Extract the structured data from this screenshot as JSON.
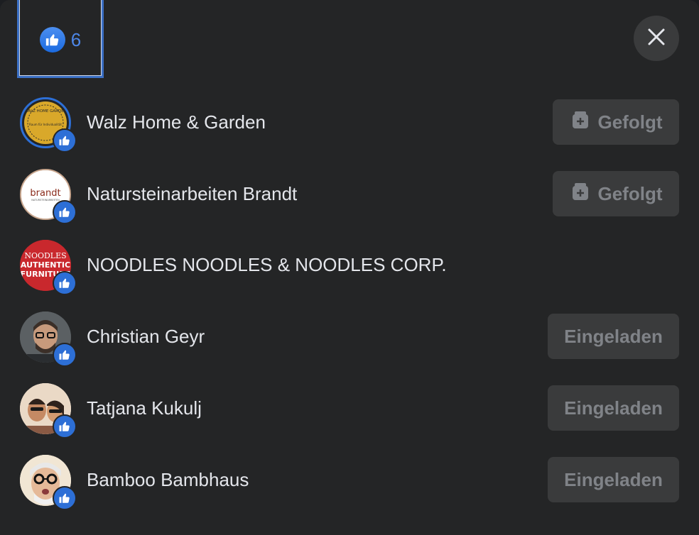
{
  "header": {
    "tab_all_count": "6",
    "tab_icon": "like-icon",
    "close_icon": "close-icon"
  },
  "colors": {
    "background": "#242526",
    "like_blue": "#2d6fd6",
    "count_blue": "#4d87e8",
    "button_bg": "#3a3b3c",
    "button_text": "#808388"
  },
  "people": [
    {
      "name": "Walz Home & Garden",
      "action": "Gefolgt",
      "action_icon": "follow-page-icon",
      "avatar_text": [
        "WALZ HOME GARDEN",
        "Raum für Individualität"
      ]
    },
    {
      "name": "Natursteinarbeiten Brandt",
      "action": "Gefolgt",
      "action_icon": "follow-page-icon",
      "avatar_text": [
        "brandt",
        "NATURSTEINARBEITEN"
      ]
    },
    {
      "name": "NOODLES NOODLES & NOODLES CORP.",
      "action": "",
      "avatar_text": [
        "NOODLES",
        "AUTHENTIC",
        "FURNITURE"
      ]
    },
    {
      "name": "Christian Geyr",
      "action": "Eingeladen"
    },
    {
      "name": "Tatjana Kukulj",
      "action": "Eingeladen"
    },
    {
      "name": "Bamboo Bambhaus",
      "action": "Eingeladen"
    }
  ]
}
